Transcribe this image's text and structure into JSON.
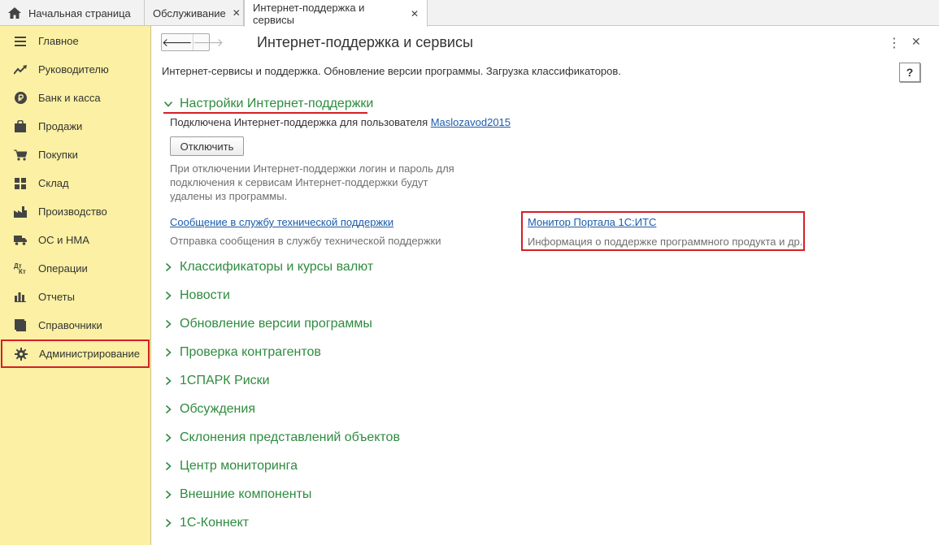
{
  "tabs": [
    {
      "label": "Начальная страница",
      "icon": "home-icon"
    },
    {
      "label": "Обслуживание",
      "close": "✕"
    },
    {
      "label": "Интернет-поддержка и сервисы",
      "close": "✕"
    }
  ],
  "sidebar": {
    "items": [
      {
        "label": "Главное",
        "icon": "menu-icon"
      },
      {
        "label": "Руководителю",
        "icon": "trend-icon"
      },
      {
        "label": "Банк и касса",
        "icon": "ruble-icon"
      },
      {
        "label": "Продажи",
        "icon": "bag-icon"
      },
      {
        "label": "Покупки",
        "icon": "cart-icon"
      },
      {
        "label": "Склад",
        "icon": "warehouse-icon"
      },
      {
        "label": "Производство",
        "icon": "factory-icon"
      },
      {
        "label": "ОС и НМА",
        "icon": "truck-icon"
      },
      {
        "label": "Операции",
        "icon": "dt-kt-icon"
      },
      {
        "label": "Отчеты",
        "icon": "bar-chart-icon"
      },
      {
        "label": "Справочники",
        "icon": "book-icon"
      },
      {
        "label": "Администрирование",
        "icon": "gear-icon"
      }
    ],
    "dt_kt": {
      "dt": "Дт",
      "kt": "Кт"
    }
  },
  "header": {
    "back": "🡐",
    "forward": "🡒",
    "title": "Интернет-поддержка и сервисы",
    "more": "⋮",
    "close": "✕",
    "description": "Интернет-сервисы и поддержка. Обновление версии программы. Загрузка классификаторов.",
    "help": "?"
  },
  "settings": {
    "title": "Настройки Интернет-поддержки",
    "connected_prefix": "Подключена Интернет-поддержка для пользователя ",
    "user_link": "Maslozavod2015",
    "disconnect_button": "Отключить",
    "disconnect_note": "При отключении Интернет-поддержки логин и пароль для подключения к сервисам Интернет-поддержки будут удалены из программы.",
    "support_link": "Сообщение в службу технической поддержки",
    "support_note": "Отправка сообщения в службу технической поддержки",
    "monitor_link": "Монитор Портала 1С:ИТС",
    "monitor_note": "Информация о поддержке программного продукта и др."
  },
  "sections": [
    {
      "title": "Классификаторы и курсы валют"
    },
    {
      "title": "Новости"
    },
    {
      "title": "Обновление версии программы"
    },
    {
      "title": "Проверка контрагентов"
    },
    {
      "title": "1СПАРК Риски"
    },
    {
      "title": "Обсуждения"
    },
    {
      "title": "Склонения представлений объектов"
    },
    {
      "title": "Центр мониторинга"
    },
    {
      "title": "Внешние компоненты"
    },
    {
      "title": "1С-Коннект"
    }
  ],
  "colors": {
    "sidebar_bg": "#fbf0a3",
    "section_green": "#2e8b3f",
    "link_blue": "#1d5ba8",
    "highlight_red": "#d31f27"
  }
}
